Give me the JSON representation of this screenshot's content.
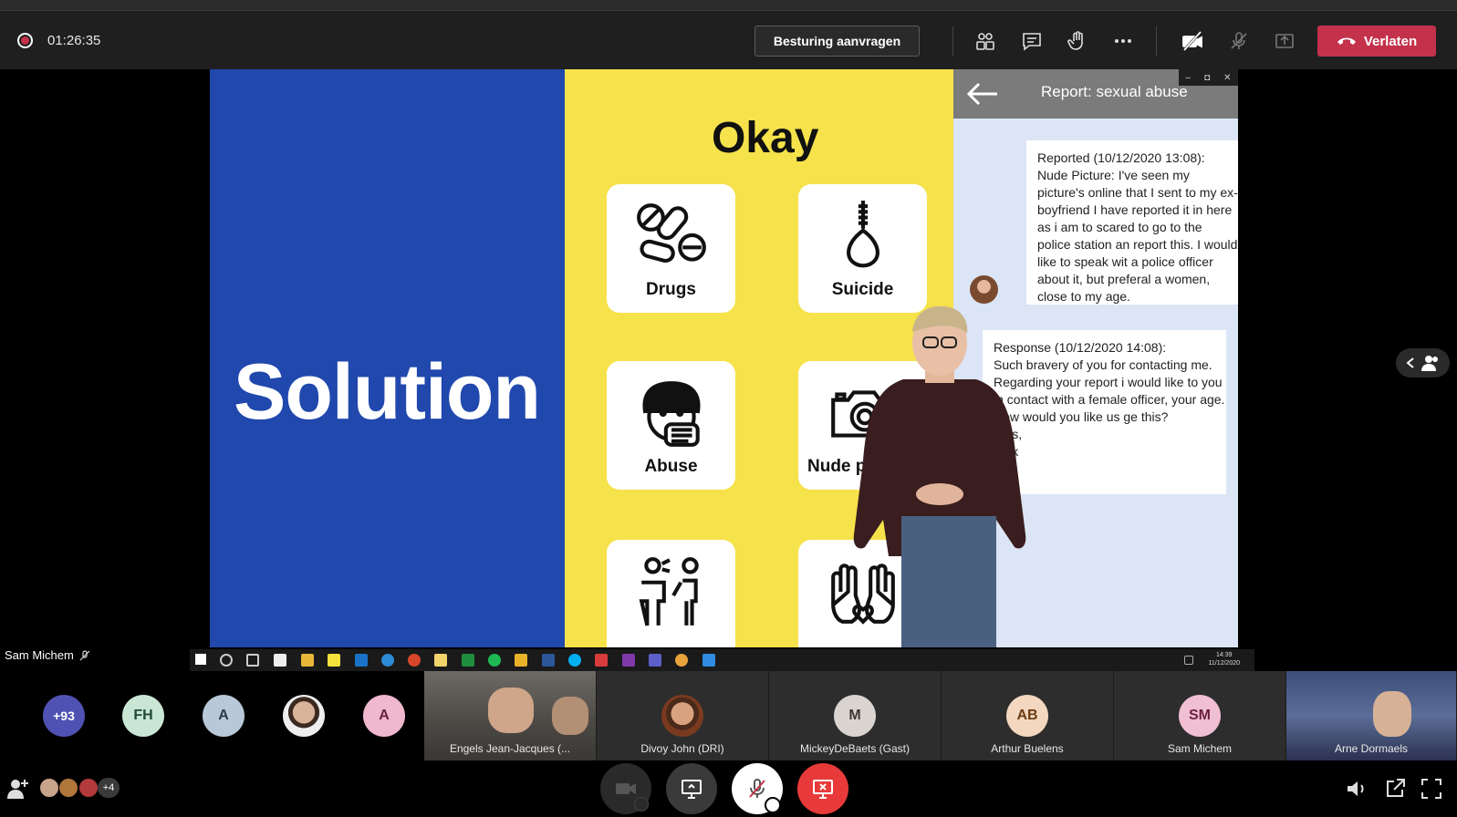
{
  "toolbar": {
    "timer": "01:26:35",
    "request_control_label": "Besturing aanvragen",
    "leave_label": "Verlaten",
    "icons": [
      "participants-icon",
      "chat-icon",
      "raise-hand-icon",
      "more-options-icon",
      "camera-off-icon",
      "microphone-off-icon",
      "share-tray-icon"
    ],
    "leave_color": "#c4314b"
  },
  "slide": {
    "left_title": "Solution",
    "heading": "Okay",
    "cards": [
      {
        "label": "Drugs",
        "icon": "pills-icon"
      },
      {
        "label": "Suicide",
        "icon": "noose-icon"
      },
      {
        "label": "Abuse",
        "icon": "covered-mouth-icon"
      },
      {
        "label": "Nude pic",
        "icon": "camera-icon"
      },
      {
        "label": "",
        "icon": "bullying-icon"
      },
      {
        "label": "",
        "icon": "helping-hands-icon"
      }
    ],
    "blue": "#2148ad",
    "yellow": "#f6e24b"
  },
  "report": {
    "title": "Report: sexual abuse",
    "message_1": "Reported (10/12/2020 13:08):\nNude Picture: I've seen my picture's online that I sent to my ex-boyfriend I have reported it in here as i am to scared to go to the police station an report this. I would like to speak wit a police officer about it, but preferal a women, close to my age.",
    "message_2": "Response (10/12/2020 14:08):\nSuch bravery of you for contacting me. Regarding your report i would like to you in contact with a female officer, your age. How would you like us ge this?\nards,\nrank"
  },
  "presenter_name": "Sam Michem",
  "taskbar": {
    "time": "14:39",
    "date": "11/12/2020"
  },
  "participants": {
    "overflow_count": "+93",
    "avatars": [
      {
        "initials": "FH",
        "bg": "#c9e6d5",
        "fg": "#1f4a34"
      },
      {
        "initials": "A",
        "bg": "#b8c8d8",
        "fg": "#2b3a4a"
      },
      {
        "initials": "A",
        "bg": "#f0b8cf",
        "fg": "#6a1f3e"
      }
    ],
    "tiles": [
      {
        "name": "Engels Jean-Jacques (...",
        "type": "video"
      },
      {
        "name": "Divoy John (DRI)",
        "type": "photo"
      },
      {
        "name": "MickeyDeBaets (Gast)",
        "initials": "M",
        "bg": "#d9d4d0",
        "fg": "#3c3632"
      },
      {
        "name": "Arthur Buelens",
        "initials": "AB",
        "bg": "#f3d7bf",
        "fg": "#6a3d16"
      },
      {
        "name": "Sam Michem",
        "initials": "SM",
        "bg": "#f0bfd3",
        "fg": "#6a1f3e"
      },
      {
        "name": "Arne Dormaels",
        "type": "video"
      }
    ]
  },
  "bottom": {
    "attendee_extra": "+4"
  }
}
